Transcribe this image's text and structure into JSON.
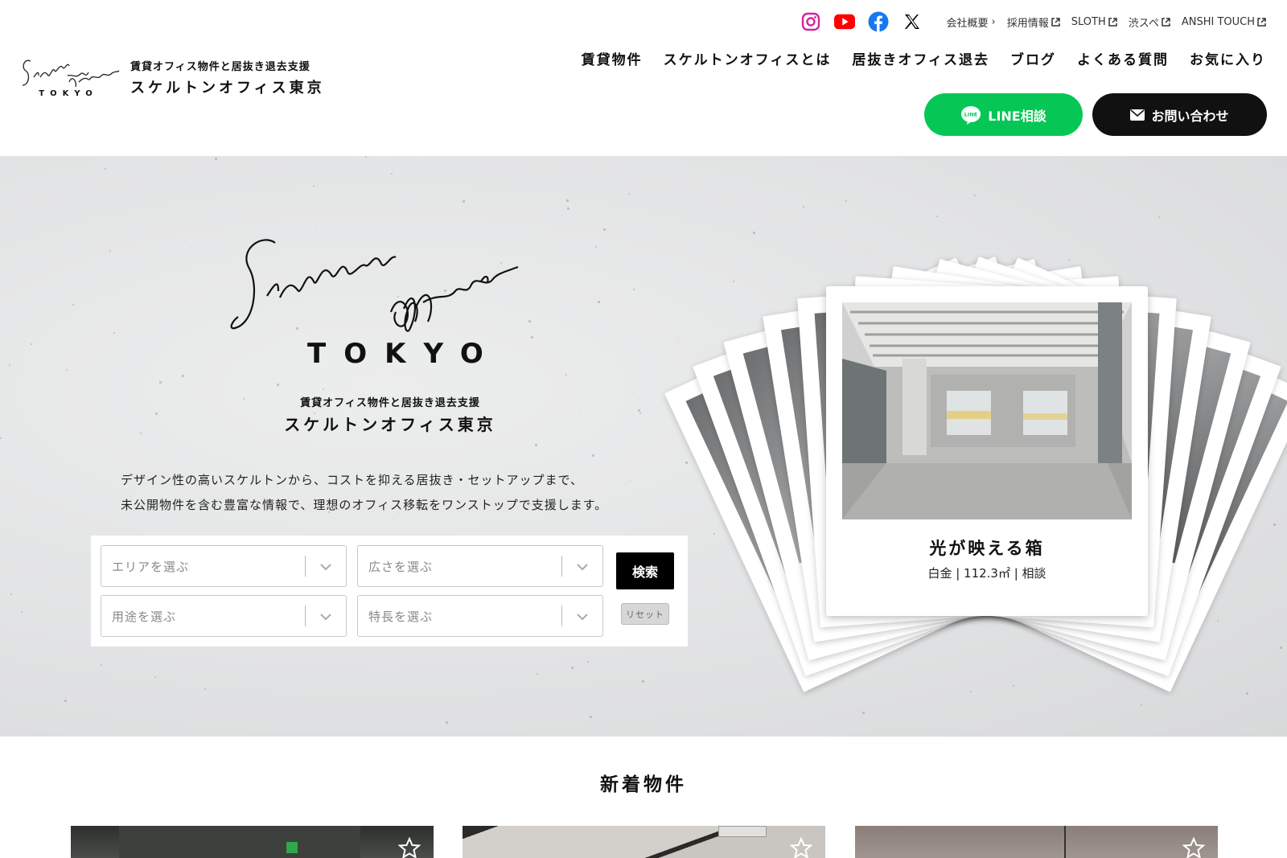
{
  "header": {
    "brand": {
      "logo_script": "Skeleton office",
      "logo_tokyo": "TOKYO",
      "tagline": "賃貸オフィス物件と居抜き退去支援",
      "name": "スケルトンオフィス東京"
    },
    "social": [
      {
        "icon": "instagram-icon",
        "color": "#d6249f"
      },
      {
        "icon": "youtube-icon",
        "color": "#ff0000"
      },
      {
        "icon": "facebook-icon",
        "color": "#1877f2"
      },
      {
        "icon": "x-icon",
        "color": "#000000"
      }
    ],
    "util_links": [
      "会社概要",
      "採用情報",
      "SLOTH",
      "渋スペ",
      "ANSHI TOUCH"
    ],
    "nav": [
      "賃貸物件",
      "スケルトンオフィスとは",
      "居抜きオフィス退去",
      "ブログ",
      "よくある質問",
      "お気に入り"
    ],
    "cta_line": "LINE相談",
    "cta_contact": "お問い合わせ",
    "line_badge": "LINE"
  },
  "hero": {
    "logo_script": "Skeleton office",
    "logo_tokyo": "TOKYO",
    "tagline": "賃貸オフィス物件と居抜き退去支援",
    "name": "スケルトンオフィス東京",
    "desc_line1": "デザイン性の高いスケルトンから、コストを抑える居抜き・セットアップまで、",
    "desc_line2": "未公開物件を含む豊富な情報で、理想のオフィス移転をワンストップで支援します。",
    "search": {
      "area_placeholder": "エリアを選ぶ",
      "size_placeholder": "広さを選ぶ",
      "use_placeholder": "用途を選ぶ",
      "feature_placeholder": "特長を選ぶ",
      "search_label": "検索",
      "reset_label": "リセット"
    },
    "featured": {
      "title": "光が映える箱",
      "meta": "白金 | 112.3㎡ | 相談"
    }
  },
  "new_listings": {
    "title": "新着物件"
  },
  "colors": {
    "line_green": "#06c755",
    "black": "#111111"
  }
}
